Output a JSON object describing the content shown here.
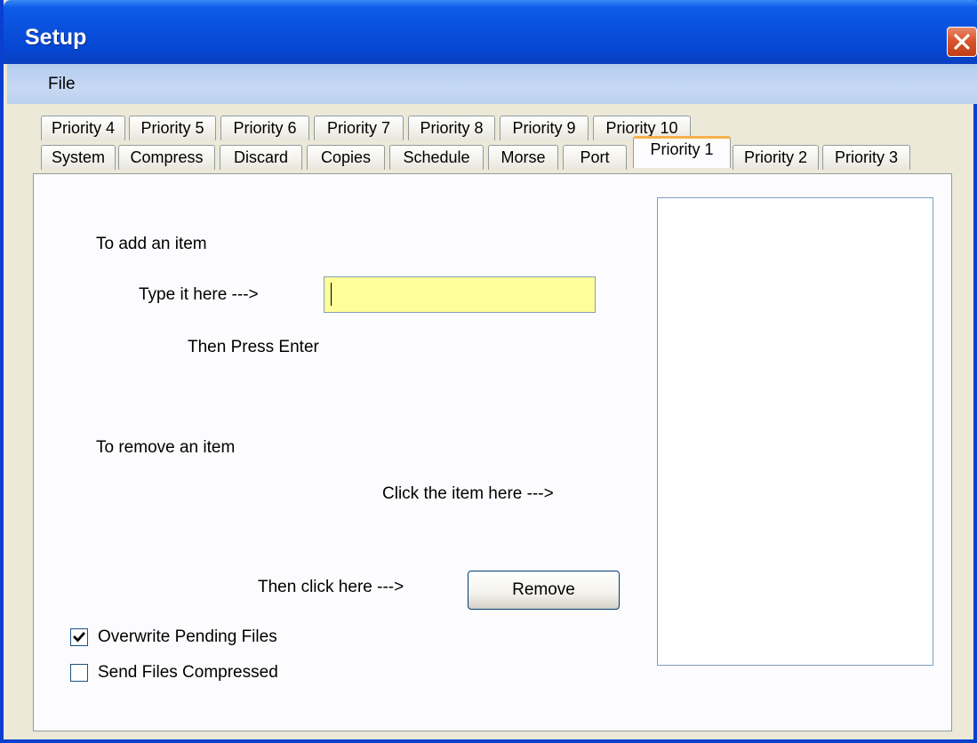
{
  "window": {
    "title": "Setup"
  },
  "menu": {
    "file": "File"
  },
  "tabs_row1": [
    "Priority 4",
    "Priority 5",
    "Priority 6",
    "Priority 7",
    "Priority 8",
    "Priority 9",
    "Priority 10"
  ],
  "tabs_row2": [
    "System",
    "Compress",
    "Discard",
    "Copies",
    "Schedule",
    "Morse",
    "Port",
    "Priority 1",
    "Priority 2",
    "Priority 3"
  ],
  "active_tab": "Priority 1",
  "add_section": {
    "heading": "To add an item",
    "type_hint": "Type it here --->",
    "enter_hint": "Then Press Enter",
    "input_value": ""
  },
  "remove_section": {
    "heading": "To remove an item",
    "click_hint": "Click the item here --->",
    "then_hint": "Then click here --->",
    "button_label": "Remove"
  },
  "options": {
    "overwrite_label": "Overwrite Pending Files",
    "overwrite_checked": true,
    "compressed_label": "Send Files Compressed",
    "compressed_checked": false
  },
  "listbox_items": [],
  "colors": {
    "titlebar": "#0a52df",
    "input_background": "#ffff99",
    "active_tab_accent": "#f6b04a",
    "close_button": "#d9562d"
  },
  "icons": {
    "close": "close-icon",
    "check": "checkmark-icon"
  }
}
